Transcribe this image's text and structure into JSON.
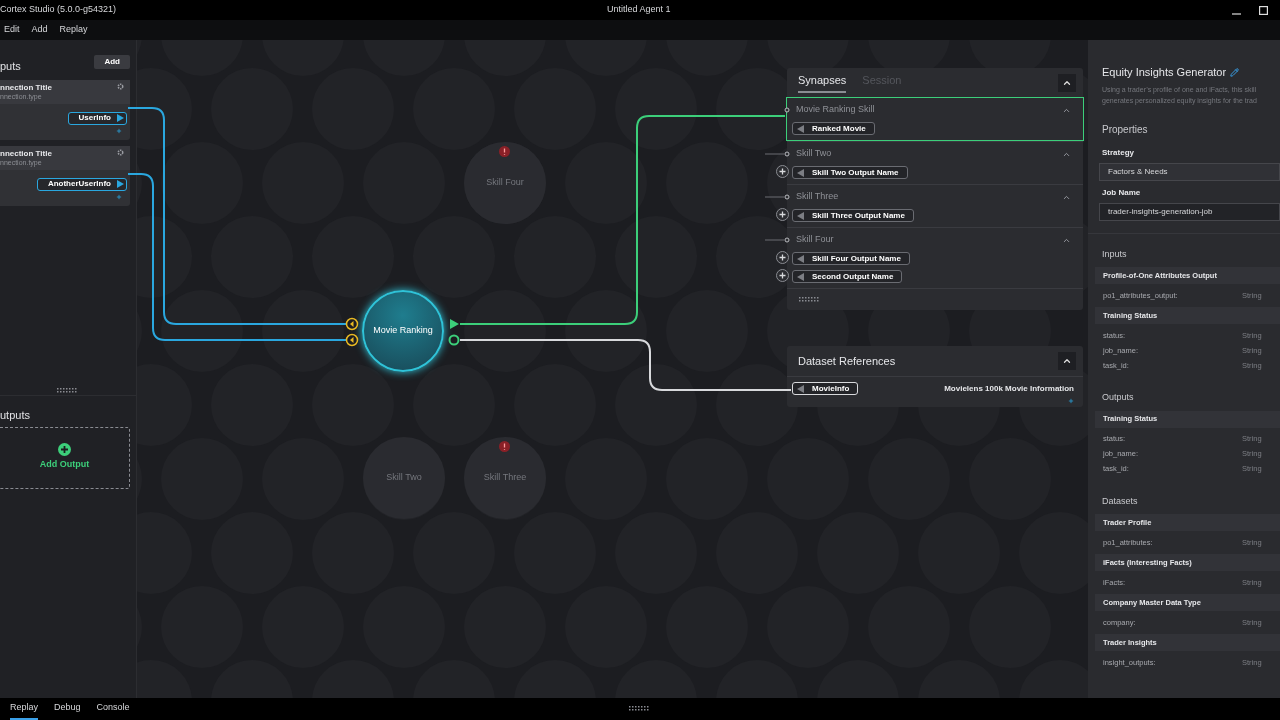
{
  "window": {
    "title": "Cortex Studio (5.0.0-g54321)",
    "document": "Untitled Agent 1"
  },
  "menu": [
    "Edit",
    "Add",
    "Replay"
  ],
  "inputs_panel": {
    "title": "puts",
    "add_button": "Add",
    "connections": [
      {
        "title": "nnection Title",
        "type": "nnection.type",
        "port": "UserInfo"
      },
      {
        "title": "nnection Title",
        "type": "nnection.type",
        "port": "AnotherUserInfo"
      }
    ]
  },
  "outputs_panel": {
    "title": "utputs",
    "add_label": "Add Output"
  },
  "canvas": {
    "nodes": [
      {
        "label": "Skill Four",
        "kind": "idle",
        "warning": true
      },
      {
        "label": "Movie Ranking",
        "kind": "active",
        "warning": false
      },
      {
        "label": "Skill Two",
        "kind": "idle",
        "warning": false
      },
      {
        "label": "Skill Three",
        "kind": "idle",
        "warning": true
      }
    ]
  },
  "synapses": {
    "tabs": [
      {
        "label": "Synapses",
        "selected": true
      },
      {
        "label": "Session",
        "selected": false
      }
    ],
    "skills": [
      {
        "name": "Movie Ranking Skill",
        "selected": true,
        "outputs": [
          "Ranked Movie"
        ]
      },
      {
        "name": "Skill Two",
        "selected": false,
        "outputs": [
          "Skill Two Output Name"
        ]
      },
      {
        "name": "Skill Three",
        "selected": false,
        "outputs": [
          "Skill Three Output Name"
        ]
      },
      {
        "name": "Skill Four",
        "selected": false,
        "outputs": [
          "Skill Four Output Name",
          "Second Output Name"
        ]
      }
    ]
  },
  "dataset_references": {
    "title": "Dataset References",
    "items": [
      {
        "port": "MovieInfo",
        "description": "Movielens 100k Movie Information"
      }
    ]
  },
  "properties": {
    "title": "Equity Insights Generator",
    "description": [
      "Using a trader’s profile of one and iFacts, this skill",
      "generates personalized equity insights for the trad"
    ],
    "heading": "Properties",
    "fields": [
      {
        "label": "Strategy",
        "kind": "select",
        "value": "Factors & Needs"
      },
      {
        "label": "Job Name",
        "kind": "text",
        "value": "trader-insights-generation-job"
      }
    ],
    "sections": [
      {
        "title": "Inputs",
        "groups": [
          {
            "title": "Profile-of-One Attributes Output",
            "rows": [
              {
                "name": "po1_attributes_output:",
                "type": "String"
              }
            ]
          },
          {
            "title": "Training Status",
            "rows": [
              {
                "name": "status:",
                "type": "String"
              },
              {
                "name": "job_name:",
                "type": "String"
              },
              {
                "name": "task_id:",
                "type": "String"
              }
            ]
          }
        ]
      },
      {
        "title": "Outputs",
        "groups": [
          {
            "title": "Training Status",
            "rows": [
              {
                "name": "status:",
                "type": "String"
              },
              {
                "name": "job_name:",
                "type": "String"
              },
              {
                "name": "task_id:",
                "type": "String"
              }
            ]
          }
        ]
      },
      {
        "title": "Datasets",
        "groups": [
          {
            "title": "Trader Profile",
            "rows": [
              {
                "name": "po1_attributes:",
                "type": "String"
              }
            ]
          },
          {
            "title": "iFacts (Interesting Facts)",
            "rows": [
              {
                "name": "iFacts:",
                "type": "String"
              }
            ]
          },
          {
            "title": "Company Master Data Type",
            "rows": [
              {
                "name": "company:",
                "type": "String"
              }
            ]
          },
          {
            "title": "Trader Insights",
            "rows": [
              {
                "name": "insight_outputs:",
                "type": "String"
              }
            ]
          }
        ]
      }
    ]
  },
  "bottom_tabs": [
    {
      "label": "Replay",
      "selected": true
    },
    {
      "label": "Debug",
      "selected": false
    },
    {
      "label": "Console",
      "selected": false
    }
  ]
}
